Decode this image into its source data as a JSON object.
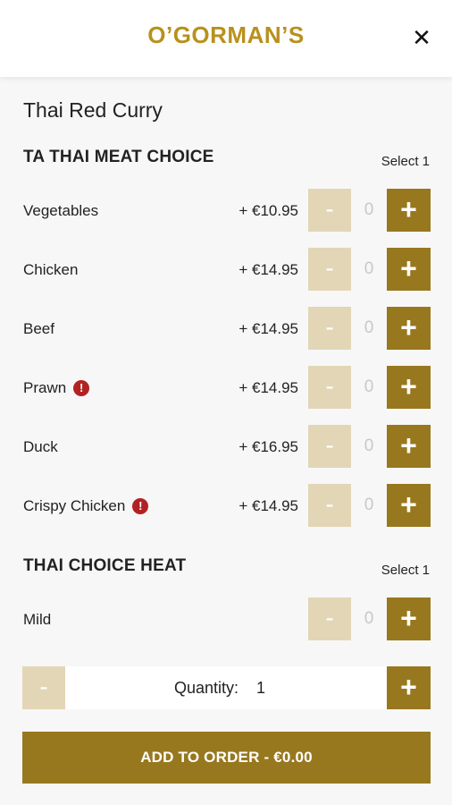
{
  "header": {
    "brand": "O’GORMAN’S",
    "close_glyph": "✕"
  },
  "dish": {
    "title": "Thai Red Curry"
  },
  "sections": [
    {
      "title": "TA THAI MEAT CHOICE",
      "select_note": "Select 1",
      "options": [
        {
          "name": "Vegetables",
          "price": "+ €10.95",
          "count": "0",
          "alert": false
        },
        {
          "name": "Chicken",
          "price": "+ €14.95",
          "count": "0",
          "alert": false
        },
        {
          "name": "Beef",
          "price": "+ €14.95",
          "count": "0",
          "alert": false
        },
        {
          "name": "Prawn",
          "price": "+ €14.95",
          "count": "0",
          "alert": true
        },
        {
          "name": "Duck",
          "price": "+ €16.95",
          "count": "0",
          "alert": false
        },
        {
          "name": "Crispy Chicken",
          "price": "+ €14.95",
          "count": "0",
          "alert": true
        }
      ]
    },
    {
      "title": "THAI CHOICE HEAT",
      "select_note": "Select 1",
      "options": [
        {
          "name": "Mild",
          "price": "",
          "count": "0",
          "alert": false
        }
      ]
    }
  ],
  "controls": {
    "minus": "-",
    "plus": "+",
    "alert_glyph": "!"
  },
  "quantity": {
    "label": "Quantity:",
    "value": "1"
  },
  "add_button": {
    "label": "ADD TO ORDER  -  €0.00"
  },
  "colors": {
    "brand": "#b8911d",
    "primary": "#98781f",
    "disabled": "#e2d6b7",
    "alert": "#b22222"
  }
}
